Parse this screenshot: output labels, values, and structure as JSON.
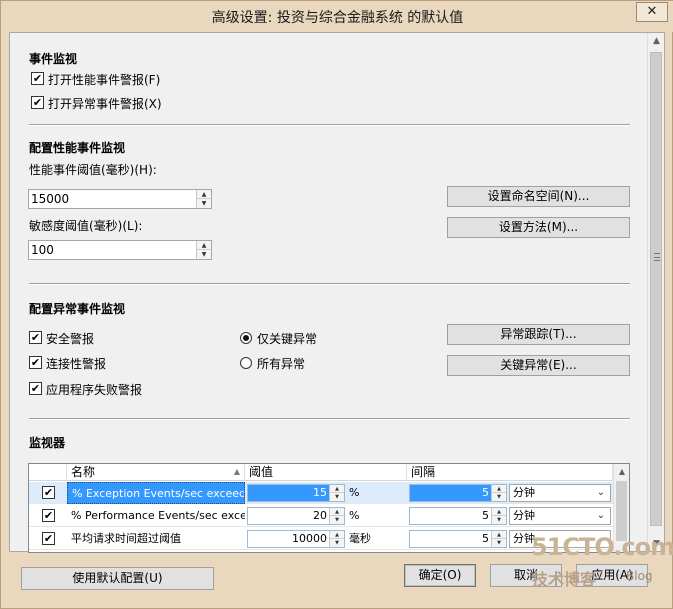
{
  "window": {
    "title": "高级设置: 投资与综合金融系统 的默认值",
    "close_glyph": "✕"
  },
  "event_monitor": {
    "title": "事件监视",
    "enable_perf": {
      "label": "打开性能事件警报(F)",
      "checked": true
    },
    "enable_exc": {
      "label": "打开异常事件警报(X)",
      "checked": true
    }
  },
  "perf_config": {
    "title": "配置性能事件监视",
    "threshold_label": "性能事件阈值(毫秒)(H):",
    "threshold_value": "15000",
    "sensitivity_label": "敏感度阈值(毫秒)(L):",
    "sensitivity_value": "100",
    "set_namespace_btn": "设置命名空间(N)...",
    "set_methods_btn": "设置方法(M)..."
  },
  "exc_config": {
    "title": "配置异常事件监视",
    "security_alert": {
      "label": "安全警报",
      "checked": true
    },
    "connectivity_alert": {
      "label": "连接性警报",
      "checked": true
    },
    "app_failure_alert": {
      "label": "应用程序失败警报",
      "checked": true
    },
    "critical_only": {
      "label": "仅关键异常",
      "selected": true
    },
    "all_exceptions": {
      "label": "所有异常",
      "selected": false
    },
    "exc_trace_btn": "异常跟踪(T)...",
    "critical_exc_btn": "关键异常(E)..."
  },
  "monitors": {
    "title": "监视器",
    "columns": [
      "名称",
      "阈值",
      "间隔"
    ],
    "sort_glyph": "▲",
    "rows": [
      {
        "checked": true,
        "name": "% Exception Events/sec exceed...",
        "threshold": "15",
        "unit": "%",
        "interval": "5",
        "interval_unit": "分钟"
      },
      {
        "checked": true,
        "name": "% Performance Events/sec exce...",
        "threshold": "20",
        "unit": "%",
        "interval": "5",
        "interval_unit": "分钟"
      },
      {
        "checked": true,
        "name": "平均请求时间超过阈值",
        "threshold": "10000",
        "unit": "毫秒",
        "interval": "5",
        "interval_unit": "分钟"
      }
    ]
  },
  "footer": {
    "use_default_btn": "使用默认配置(U)",
    "ok_btn": "确定(O)",
    "cancel_btn": "取消",
    "apply_btn": "应用(A)"
  },
  "watermark": {
    "site": "51CTO.com",
    "sub": "技术博客",
    "blog": "Blog"
  },
  "colors": {
    "frame": "#e9d7be",
    "client": "#f0f0f0",
    "selection": "#3399ff"
  }
}
